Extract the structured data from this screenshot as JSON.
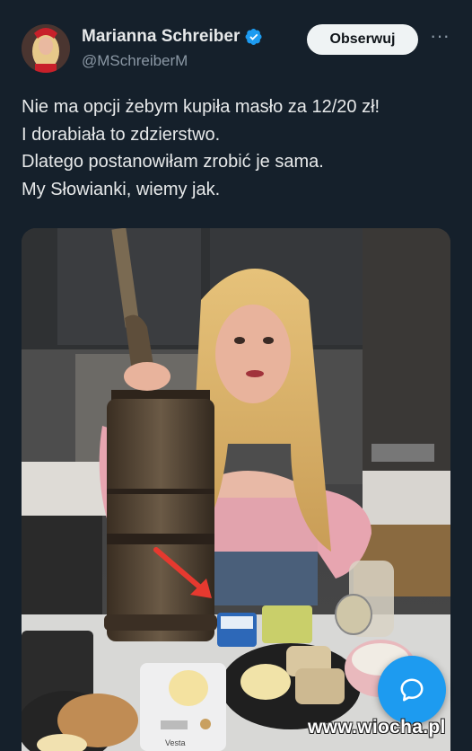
{
  "author": {
    "name": "Marianna Schreiber",
    "handle": "@MSchreiberM",
    "verified": true
  },
  "actions": {
    "follow_label": "Obserwuj",
    "more_label": "···"
  },
  "tweet": {
    "lines": [
      "Nie ma opcji żebym kupiła masło za 12/20 zł!",
      "I dorabiała to zdzierstwo.",
      "Dlatego postanowiłam zrobić je sama.",
      "My Słowianki, wiemy jak."
    ]
  },
  "media": {
    "scale_brand": "Vesta"
  },
  "watermark": "www.wiocha.pl",
  "colors": {
    "background": "#15202b",
    "accent": "#1d9bf0",
    "text": "#e7e9ea",
    "secondary_text": "#8b98a5"
  },
  "icons": {
    "verified": "verified-badge-icon",
    "reply": "reply-bubble-icon"
  }
}
